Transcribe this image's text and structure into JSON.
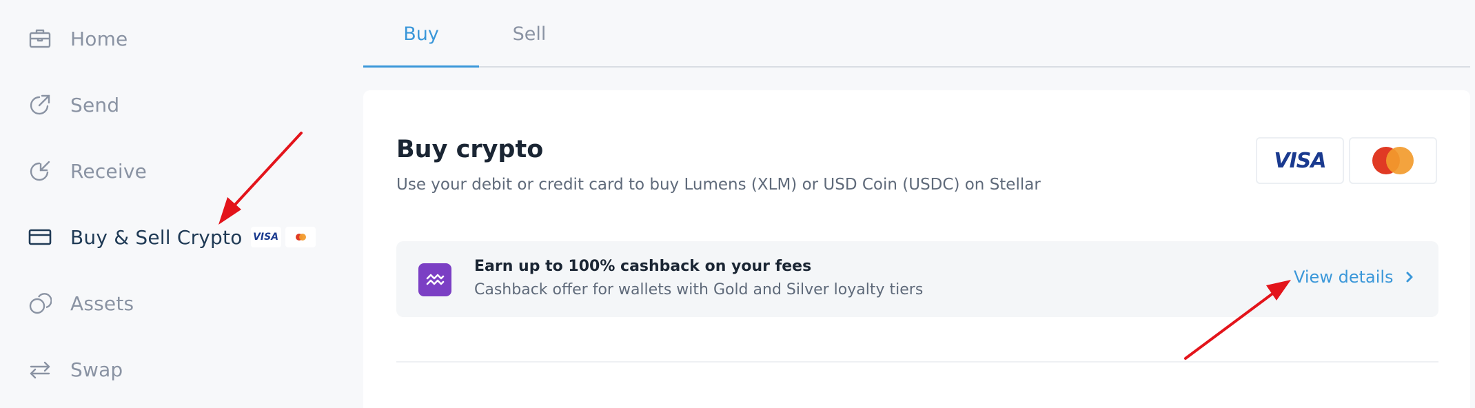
{
  "sidebar": {
    "items": [
      {
        "label": "Home",
        "icon": "briefcase-icon",
        "active": false
      },
      {
        "label": "Send",
        "icon": "arrow-up-right-icon",
        "active": false
      },
      {
        "label": "Receive",
        "icon": "arrow-down-left-icon",
        "active": false
      },
      {
        "label": "Buy & Sell Crypto",
        "icon": "credit-card-icon",
        "active": true,
        "badge_visa": "VISA"
      },
      {
        "label": "Assets",
        "icon": "coins-icon",
        "active": false
      },
      {
        "label": "Swap",
        "icon": "swap-arrows-icon",
        "active": false
      }
    ]
  },
  "tabs": [
    {
      "label": "Buy",
      "active": true
    },
    {
      "label": "Sell",
      "active": false
    }
  ],
  "card": {
    "title": "Buy crypto",
    "subtitle": "Use your debit or credit card to buy Lumens (XLM) or USD Coin (USDC) on Stellar",
    "brands": {
      "visa": "VISA",
      "mastercard_icon": "mastercard-icon"
    },
    "cashback": {
      "icon": "cashback-waves-icon",
      "title": "Earn up to 100% cashback on your fees",
      "subtitle": "Cashback offer for wallets with Gold and Silver loyalty tiers",
      "link_label": "View details"
    }
  },
  "colors": {
    "accent": "#3a97d9",
    "annotation_arrow": "#e3141b",
    "cashback_icon_bg": "#7b3fc4",
    "visa_blue": "#1a3a8f",
    "mastercard_red": "#e03a24",
    "mastercard_orange": "#f29b2e"
  }
}
